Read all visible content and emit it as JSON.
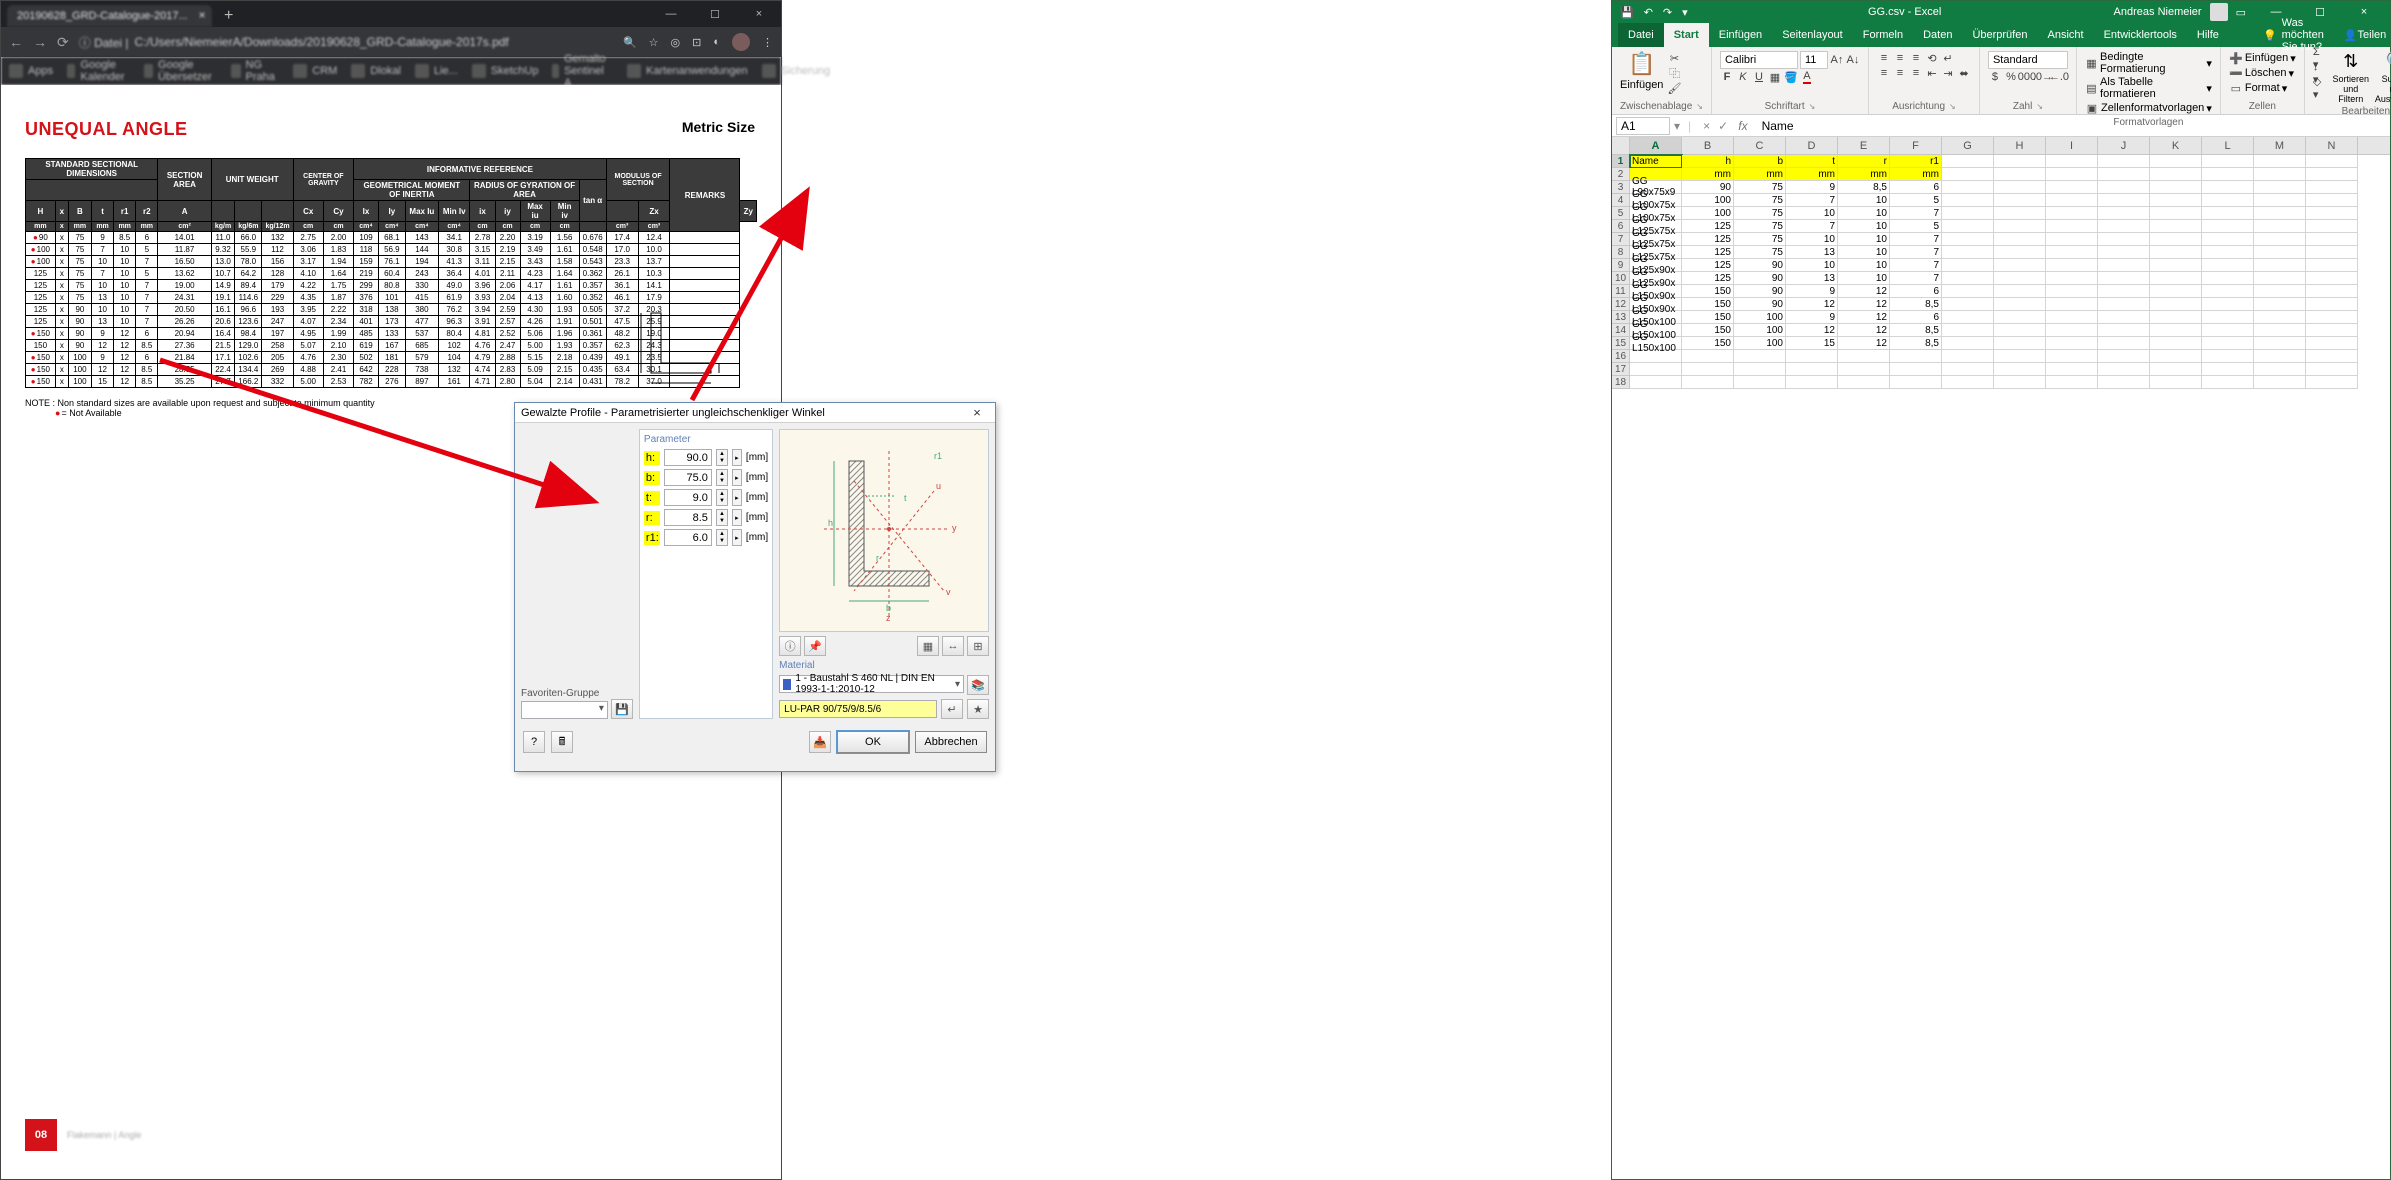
{
  "browser": {
    "tab_title": "20190628_GRD-Catalogue-2017...",
    "url_prefix": "ⓘ Datei |",
    "url": "C:/Users/NiemeierA/Downloads/20190628_GRD-Catalogue-2017s.pdf",
    "bookmark_label": "Apps",
    "bookmarks": [
      "Google Kalender",
      "Google Übersetzer",
      "NG Praha",
      "CRM",
      "Dlokal",
      "Lie...",
      "SketchUp",
      "Gemalto Sentinel A...",
      "Kartenanwendungen",
      "Sicherung"
    ],
    "page": {
      "heading": "UNEQUAL ANGLE",
      "metric": "Metric Size",
      "header": {
        "std": "STANDARD SECTIONAL DIMENSIONS",
        "area": "SECTION AREA",
        "unitw": "UNIT WEIGHT",
        "cog": "CENTER OF GRAVITY",
        "info": "INFORMATIVE REFERENCE",
        "gmi": "GEOMETRICAL MOMENT OF INERTIA",
        "rog": "RADIUS OF GYRATION OF AREA",
        "tan": "tan α",
        "mos": "MODULUS OF SECTION",
        "rem": "REMARKS",
        "sub": [
          "H",
          "x",
          "B",
          "t",
          "r1",
          "r2",
          "A",
          "",
          "",
          "",
          "Cx",
          "Cy",
          "Ix",
          "Iy",
          "Max Iu",
          "Min Iv",
          "ix",
          "iy",
          "Max iu",
          "Min iv",
          "",
          "Zx",
          "Zy"
        ],
        "units": [
          "mm",
          "x",
          "mm",
          "mm",
          "mm",
          "mm",
          "cm²",
          "kg/m",
          "kg/6m",
          "kg/12m",
          "cm",
          "cm",
          "cm⁴",
          "cm⁴",
          "cm⁴",
          "cm⁴",
          "cm",
          "cm",
          "cm",
          "cm",
          "",
          "cm³",
          "cm³"
        ]
      },
      "rows": [
        {
          "d": [
            "90",
            "x",
            "75",
            "9",
            "8.5",
            "6"
          ],
          "a": "14.01",
          "w": [
            "11.0",
            "66.0",
            "132"
          ],
          "c": [
            "2.75",
            "2.00"
          ],
          "i": [
            "109",
            "68.1",
            "143",
            "34.1"
          ],
          "r": [
            "2.78",
            "2.20",
            "3.19",
            "1.56"
          ],
          "t": "0.676",
          "z": [
            "17.4",
            "12.4"
          ],
          "red": true
        },
        {
          "d": [
            "100",
            "x",
            "75",
            "7",
            "10",
            "5"
          ],
          "a": "11.87",
          "w": [
            "9.32",
            "55.9",
            "112"
          ],
          "c": [
            "3.06",
            "1.83"
          ],
          "i": [
            "118",
            "56.9",
            "144",
            "30.8"
          ],
          "r": [
            "3.15",
            "2.19",
            "3.49",
            "1.61"
          ],
          "t": "0.548",
          "z": [
            "17.0",
            "10.0"
          ],
          "red": true
        },
        {
          "d": [
            "100",
            "x",
            "75",
            "10",
            "10",
            "7"
          ],
          "a": "16.50",
          "w": [
            "13.0",
            "78.0",
            "156"
          ],
          "c": [
            "3.17",
            "1.94"
          ],
          "i": [
            "159",
            "76.1",
            "194",
            "41.3"
          ],
          "r": [
            "3.11",
            "2.15",
            "3.43",
            "1.58"
          ],
          "t": "0.543",
          "z": [
            "23.3",
            "13.7"
          ],
          "red": true
        },
        {
          "d": [
            "125",
            "x",
            "75",
            "7",
            "10",
            "5"
          ],
          "a": "13.62",
          "w": [
            "10.7",
            "64.2",
            "128"
          ],
          "c": [
            "4.10",
            "1.64"
          ],
          "i": [
            "219",
            "60.4",
            "243",
            "36.4"
          ],
          "r": [
            "4.01",
            "2.11",
            "4.23",
            "1.64"
          ],
          "t": "0.362",
          "z": [
            "26.1",
            "10.3"
          ],
          "red": false
        },
        {
          "d": [
            "125",
            "x",
            "75",
            "10",
            "10",
            "7"
          ],
          "a": "19.00",
          "w": [
            "14.9",
            "89.4",
            "179"
          ],
          "c": [
            "4.22",
            "1.75"
          ],
          "i": [
            "299",
            "80.8",
            "330",
            "49.0"
          ],
          "r": [
            "3.96",
            "2.06",
            "4.17",
            "1.61"
          ],
          "t": "0.357",
          "z": [
            "36.1",
            "14.1"
          ],
          "red": false
        },
        {
          "d": [
            "125",
            "x",
            "75",
            "13",
            "10",
            "7"
          ],
          "a": "24.31",
          "w": [
            "19.1",
            "114.6",
            "229"
          ],
          "c": [
            "4.35",
            "1.87"
          ],
          "i": [
            "376",
            "101",
            "415",
            "61.9"
          ],
          "r": [
            "3.93",
            "2.04",
            "4.13",
            "1.60"
          ],
          "t": "0.352",
          "z": [
            "46.1",
            "17.9"
          ],
          "red": false
        },
        {
          "d": [
            "125",
            "x",
            "90",
            "10",
            "10",
            "7"
          ],
          "a": "20.50",
          "w": [
            "16.1",
            "96.6",
            "193"
          ],
          "c": [
            "3.95",
            "2.22"
          ],
          "i": [
            "318",
            "138",
            "380",
            "76.2"
          ],
          "r": [
            "3.94",
            "2.59",
            "4.30",
            "1.93"
          ],
          "t": "0.505",
          "z": [
            "37.2",
            "20.3"
          ],
          "red": false
        },
        {
          "d": [
            "125",
            "x",
            "90",
            "13",
            "10",
            "7"
          ],
          "a": "26.26",
          "w": [
            "20.6",
            "123.6",
            "247"
          ],
          "c": [
            "4.07",
            "2.34"
          ],
          "i": [
            "401",
            "173",
            "477",
            "96.3"
          ],
          "r": [
            "3.91",
            "2.57",
            "4.26",
            "1.91"
          ],
          "t": "0.501",
          "z": [
            "47.5",
            "25.9"
          ],
          "red": false
        },
        {
          "d": [
            "150",
            "x",
            "90",
            "9",
            "12",
            "6"
          ],
          "a": "20.94",
          "w": [
            "16.4",
            "98.4",
            "197"
          ],
          "c": [
            "4.95",
            "1.99"
          ],
          "i": [
            "485",
            "133",
            "537",
            "80.4"
          ],
          "r": [
            "4.81",
            "2.52",
            "5.06",
            "1.96"
          ],
          "t": "0.361",
          "z": [
            "48.2",
            "19.0"
          ],
          "red": true
        },
        {
          "d": [
            "150",
            "x",
            "90",
            "12",
            "12",
            "8.5"
          ],
          "a": "27.36",
          "w": [
            "21.5",
            "129.0",
            "258"
          ],
          "c": [
            "5.07",
            "2.10"
          ],
          "i": [
            "619",
            "167",
            "685",
            "102"
          ],
          "r": [
            "4.76",
            "2.47",
            "5.00",
            "1.93"
          ],
          "t": "0.357",
          "z": [
            "62.3",
            "24.3"
          ],
          "red": false
        },
        {
          "d": [
            "150",
            "x",
            "100",
            "9",
            "12",
            "6"
          ],
          "a": "21.84",
          "w": [
            "17.1",
            "102.6",
            "205"
          ],
          "c": [
            "4.76",
            "2.30"
          ],
          "i": [
            "502",
            "181",
            "579",
            "104"
          ],
          "r": [
            "4.79",
            "2.88",
            "5.15",
            "2.18"
          ],
          "t": "0.439",
          "z": [
            "49.1",
            "23.5"
          ],
          "red": true
        },
        {
          "d": [
            "150",
            "x",
            "100",
            "12",
            "12",
            "8.5"
          ],
          "a": "28.55",
          "w": [
            "22.4",
            "134.4",
            "269"
          ],
          "c": [
            "4.88",
            "2.41"
          ],
          "i": [
            "642",
            "228",
            "738",
            "132"
          ],
          "r": [
            "4.74",
            "2.83",
            "5.09",
            "2.15"
          ],
          "t": "0.435",
          "z": [
            "63.4",
            "30.1"
          ],
          "red": true
        },
        {
          "d": [
            "150",
            "x",
            "100",
            "15",
            "12",
            "8.5"
          ],
          "a": "35.25",
          "w": [
            "27.7",
            "166.2",
            "332"
          ],
          "c": [
            "5.00",
            "2.53"
          ],
          "i": [
            "782",
            "276",
            "897",
            "161"
          ],
          "r": [
            "4.71",
            "2.80",
            "5.04",
            "2.14"
          ],
          "t": "0.431",
          "z": [
            "78.2",
            "37.0"
          ],
          "red": true
        }
      ],
      "note": "NOTE : Non standard sizes are available upon request and subject to minimum quantity",
      "note2": "= Not Available",
      "pagenum": "08",
      "footer_txt": "Flakemann | Angle"
    }
  },
  "excel": {
    "title": "GG.csv - Excel",
    "account": "Andreas Niemeier",
    "tabs": [
      "Datei",
      "Start",
      "Einfügen",
      "Seitenlayout",
      "Formeln",
      "Daten",
      "Überprüfen",
      "Ansicht",
      "Entwicklertools",
      "Hilfe"
    ],
    "tell": "Was möchten Sie tun?",
    "share": "Teilen",
    "ribbon": {
      "clipboard": {
        "paste": "Einfügen",
        "label": "Zwischenablage"
      },
      "font": {
        "name": "Calibri",
        "size": "11",
        "label": "Schriftart",
        "buttons": [
          "F",
          "K",
          "U"
        ]
      },
      "align": {
        "label": "Ausrichtung",
        "wrap": ""
      },
      "number": {
        "fmt": "Standard",
        "label": "Zahl"
      },
      "styles": {
        "cond": "Bedingte Formatierung",
        "table": "Als Tabelle formatieren",
        "cell": "Zellenformatvorlagen",
        "label": "Formatvorlagen"
      },
      "cells": {
        "ins": "Einfügen",
        "del": "Löschen",
        "fmt": "Format",
        "label": "Zellen"
      },
      "editing": {
        "sort": "Sortieren und Filtern",
        "find": "Suchen und Auswählen",
        "label": "Bearbeiten"
      }
    },
    "namebox": "A1",
    "formula": "Name",
    "cols": [
      "A",
      "B",
      "C",
      "D",
      "E",
      "F",
      "G",
      "H",
      "I",
      "J",
      "K",
      "L",
      "M",
      "N"
    ],
    "header_row": [
      "Name",
      "h",
      "b",
      "t",
      "r",
      "r1"
    ],
    "unit_row": [
      "",
      "mm",
      "mm",
      "mm",
      "mm",
      "mm"
    ],
    "data": [
      [
        "GG L90x75x9",
        "90",
        "75",
        "9",
        "8,5",
        "6"
      ],
      [
        "GG L100x75x",
        "100",
        "75",
        "7",
        "10",
        "5"
      ],
      [
        "GG L100x75x",
        "100",
        "75",
        "10",
        "10",
        "7"
      ],
      [
        "GG L125x75x",
        "125",
        "75",
        "7",
        "10",
        "5"
      ],
      [
        "GG L125x75x",
        "125",
        "75",
        "10",
        "10",
        "7"
      ],
      [
        "GG L125x75x",
        "125",
        "75",
        "13",
        "10",
        "7"
      ],
      [
        "GG L125x90x",
        "125",
        "90",
        "10",
        "10",
        "7"
      ],
      [
        "GG L125x90x",
        "125",
        "90",
        "13",
        "10",
        "7"
      ],
      [
        "GG L150x90x",
        "150",
        "90",
        "9",
        "12",
        "6"
      ],
      [
        "GG L150x90x",
        "150",
        "90",
        "12",
        "12",
        "8,5"
      ],
      [
        "GG L150x100",
        "150",
        "100",
        "9",
        "12",
        "6"
      ],
      [
        "GG L150x100",
        "150",
        "100",
        "12",
        "12",
        "8,5"
      ],
      [
        "GG L150x100",
        "150",
        "100",
        "15",
        "12",
        "8,5"
      ]
    ]
  },
  "dialog": {
    "title": "Gewalzte Profile - Parametrisierter ungleichschenkliger Winkel",
    "param_label": "Parameter",
    "params": [
      {
        "k": "h:",
        "v": "90.0",
        "u": "[mm]"
      },
      {
        "k": "b:",
        "v": "75.0",
        "u": "[mm]"
      },
      {
        "k": "t:",
        "v": "9.0",
        "u": "[mm]"
      },
      {
        "k": "r:",
        "v": "8.5",
        "u": "[mm]"
      },
      {
        "k": "r1:",
        "v": "6.0",
        "u": "[mm]"
      }
    ],
    "fav_label": "Favoriten-Gruppe",
    "material_label": "Material",
    "material": "1 - Baustahl S 460 NL | DIN EN 1993-1-1:2010-12",
    "code": "LU-PAR 90/75/9/8.5/6",
    "ok": "OK",
    "cancel": "Abbrechen"
  }
}
